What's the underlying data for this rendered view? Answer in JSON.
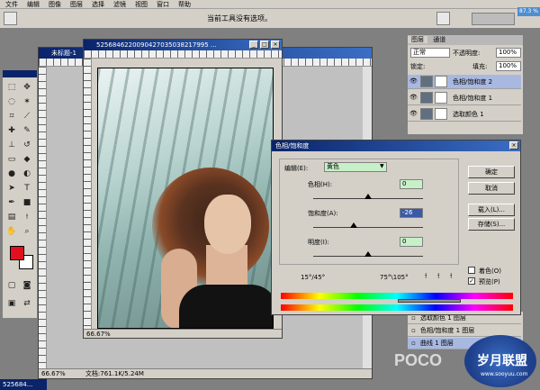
{
  "menu": [
    "文件",
    "编辑",
    "图像",
    "图层",
    "选择",
    "滤镜",
    "视图",
    "窗口",
    "帮助"
  ],
  "options_hint": "当前工具没有选项。",
  "overlay_zoom": "87.3 %",
  "bg_doc": {
    "title": "未标题-1",
    "zoom": "66.67%",
    "doc_info": "文档:761.1K/5.24M",
    "taskbar_label": "525684..."
  },
  "photo_doc": {
    "title": "5256846220090427035038217995 ...",
    "zoom": "66.67%"
  },
  "dialog": {
    "title": "色相/饱和度",
    "edit_label": "编辑(E):",
    "edit_value": "黄色",
    "hue_label": "色相(H):",
    "hue_value": "0",
    "hue_pos": 0.5,
    "sat_label": "饱和度(A):",
    "sat_value": "-26",
    "sat_pos": 0.37,
    "light_label": "明度(I):",
    "light_value": "0",
    "light_pos": 0.5,
    "range_left": "15°/45°",
    "range_right": "75°\\105°",
    "ok": "确定",
    "cancel": "取消",
    "load": "载入(L)...",
    "save": "存储(S)...",
    "colorize": "着色(O)",
    "preview": "预览(P)"
  },
  "layers_panel": {
    "tabs": [
      "图层",
      "通道"
    ],
    "opacity_label": "不透明度:",
    "opacity_value": "100%",
    "mode_value": "正常",
    "lock_label": "锁定:",
    "fill_label": "填充:",
    "fill_value": "100%",
    "layers": [
      "色相/饱和度 2",
      "色相/饱和度 1",
      "选取颜色 1"
    ]
  },
  "history_panel": {
    "items": [
      "选取颜色 1 图层",
      "色相/饱和度 1 图层",
      "曲线 1 图层"
    ]
  },
  "watermark": {
    "poco": "POCO",
    "site": "岁月联盟",
    "url": "www.sooyuu.com"
  },
  "colors": {
    "foreground": "#e01020",
    "title_blue": "#0a246a",
    "input_green": "#c8f0c8"
  }
}
